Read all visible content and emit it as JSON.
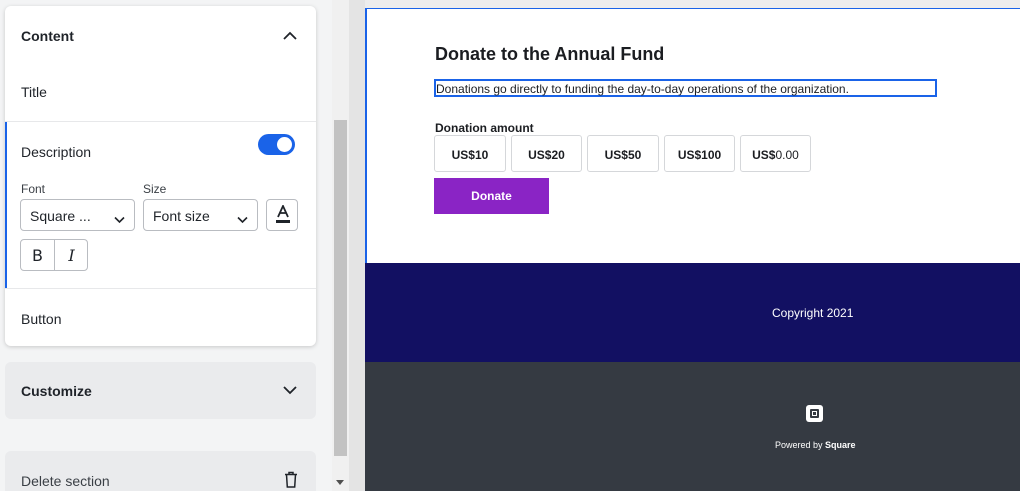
{
  "editor": {
    "content_section": {
      "title": "Content",
      "items": {
        "title": "Title",
        "description": "Description",
        "button": "Button"
      },
      "description_visible": true,
      "font_label": "Font",
      "font_value": "Square ...",
      "size_label": "Size",
      "size_placeholder": "Font size",
      "bold_label": "B",
      "italic_label": "I"
    },
    "customize_label": "Customize",
    "delete_label": "Delete section"
  },
  "preview": {
    "heading": "Donate to the Annual Fund",
    "description": "Donations go directly to funding the day-to-day operations of the organization.",
    "amount_label": "Donation amount",
    "amounts": [
      {
        "currency": "US$",
        "value": "10"
      },
      {
        "currency": "US$",
        "value": "20"
      },
      {
        "currency": "US$",
        "value": "50"
      },
      {
        "currency": "US$",
        "value": "100"
      },
      {
        "currency": "US$",
        "value": "0.00"
      }
    ],
    "donate_label": "Donate",
    "copyright": "Copyright 2021",
    "powered_by_prefix": "Powered by ",
    "powered_by_brand": "Square"
  },
  "colors": {
    "accent": "#1a63e8",
    "donate_button": "#8a24c5",
    "footer_top": "#121062",
    "footer_bottom": "#353a42"
  },
  "icons": {
    "collapse": "chevron-up-icon",
    "expand": "chevron-down-icon",
    "delete": "trash-icon",
    "text_color": "text-color-icon",
    "logo": "square-logo-icon"
  }
}
